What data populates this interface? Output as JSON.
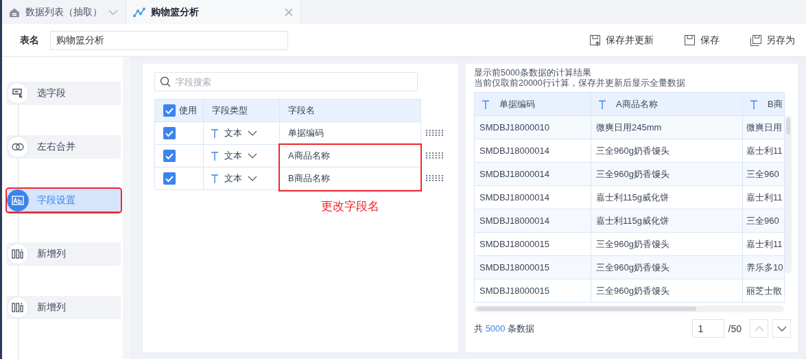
{
  "tabs": [
    {
      "label": "数据列表（抽取）",
      "kind": "home",
      "selected": false
    },
    {
      "label": "购物篮分析",
      "kind": "analysis",
      "selected": true
    }
  ],
  "toolbar": {
    "name_label": "表名",
    "name_value": "购物篮分析",
    "buttons": [
      {
        "label": "保存并更新",
        "kind": "save-update"
      },
      {
        "label": "保存",
        "kind": "save"
      },
      {
        "label": "另存为",
        "kind": "save-as"
      }
    ]
  },
  "steps": [
    {
      "label": "选字段",
      "kind": "select",
      "selected": false,
      "annotated": false
    },
    {
      "label": "左右合并",
      "kind": "merge",
      "selected": false,
      "annotated": false
    },
    {
      "label": "字段设置",
      "kind": "fields",
      "selected": true,
      "annotated": true
    },
    {
      "label": "新增列",
      "kind": "columns",
      "selected": false,
      "annotated": false
    },
    {
      "label": "新增列",
      "kind": "columns",
      "selected": false,
      "annotated": false
    }
  ],
  "field_panel": {
    "search_placeholder": "字段搜索",
    "columns": [
      "使用",
      "字段类型",
      "字段名"
    ],
    "all_checked": true,
    "rows": [
      {
        "checked": true,
        "type": "文本",
        "name": "单据编码",
        "annotated": false
      },
      {
        "checked": true,
        "type": "文本",
        "name": "A商品名称",
        "annotated": true
      },
      {
        "checked": true,
        "type": "文本",
        "name": "B商品名称",
        "annotated": true
      }
    ],
    "annotation": "更改字段名"
  },
  "preview": {
    "notice": "显示前5000条数据的计算结果",
    "notice_2": "当前仅取前20000行计算，保存并更新后显示全量数据",
    "columns": [
      "单据编码",
      "A商品名称",
      "B商"
    ],
    "rows": [
      [
        "SMDBJ18000010",
        "微爽日用245mm",
        "微爽日用"
      ],
      [
        "SMDBJ18000014",
        "三全960g奶香馒头",
        "嘉士利11"
      ],
      [
        "SMDBJ18000014",
        "三全960g奶香馒头",
        "三全960"
      ],
      [
        "SMDBJ18000014",
        "嘉士利115g威化饼",
        "嘉士利11"
      ],
      [
        "SMDBJ18000014",
        "嘉士利115g威化饼",
        "三全960"
      ],
      [
        "SMDBJ18000015",
        "三全960g奶香馒头",
        "嘉士利11"
      ],
      [
        "SMDBJ18000015",
        "三全960g奶香馒头",
        "养乐多10"
      ],
      [
        "SMDBJ18000015",
        "三全960g奶香馒头",
        "丽芝士散"
      ]
    ],
    "footer": {
      "prefix": "共",
      "count": "5000",
      "suffix": "条数据"
    },
    "page": "1",
    "page_total": "/50"
  }
}
